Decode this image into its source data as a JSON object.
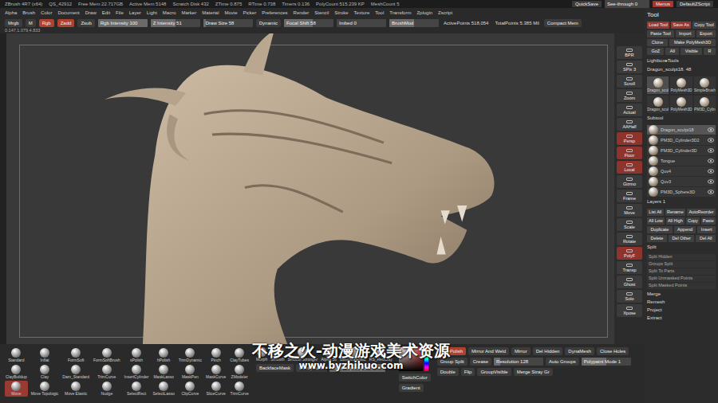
{
  "title_bar": {
    "app": "ZBrush 4R7 (x64)",
    "items": [
      "QS_42912",
      "Free Mem 22.717GB",
      "Active Mem 5148",
      "Scratch Disk 432",
      "ZTime 0.875",
      "RTime 0.738",
      "Timers 0.136",
      "PolyCount 515.239 KP",
      "MeshCount 5"
    ],
    "right": [
      {
        "label": "QuickSave",
        "kind": "button",
        "selected": false,
        "level": 0
      },
      {
        "label": "See-through 0",
        "kind": "slider",
        "selected": false,
        "level": 0
      },
      {
        "label": "Menus",
        "kind": "button",
        "selected": true,
        "level": 0
      },
      {
        "label": "DefaultZScript",
        "kind": "button",
        "selected": false,
        "level": 0
      }
    ]
  },
  "menu": [
    "Alpha",
    "Brush",
    "Color",
    "Document",
    "Draw",
    "Edit",
    "File",
    "Layer",
    "Light",
    "Macro",
    "Marker",
    "Material",
    "Movie",
    "Picker",
    "Preferences",
    "Render",
    "Stencil",
    "Stroke",
    "Texture",
    "Tool",
    "Transform",
    "Zplugin",
    "Zscript"
  ],
  "top_shelf": {
    "coords": "0.147,1.079,4.833",
    "items": [
      {
        "label": "Mrgb",
        "kind": "button",
        "selected": false,
        "level": 0
      },
      {
        "label": "M",
        "kind": "button",
        "selected": false,
        "level": 0
      },
      {
        "label": "Rgb",
        "kind": "button",
        "selected": true,
        "level": 0
      },
      {
        "label": "Zadd",
        "kind": "button",
        "selected": true,
        "level": 0
      },
      {
        "label": "Zsub",
        "kind": "button",
        "selected": false,
        "level": 0
      },
      {
        "label": "Rgb Intensity 100",
        "kind": "slider",
        "selected": false,
        "level": 1
      },
      {
        "label": "Z Intensity 51",
        "kind": "slider",
        "selected": false,
        "level": 0.51
      },
      {
        "label": "Draw Size 58",
        "kind": "slider",
        "selected": false,
        "level": 0.06
      },
      {
        "label": "Dynamic",
        "kind": "button",
        "selected": false,
        "level": 0
      },
      {
        "label": "Focal Shift 58",
        "kind": "slider",
        "selected": false,
        "level": 0.58
      },
      {
        "label": "Imbed 0",
        "kind": "slider",
        "selected": false,
        "level": 0
      },
      {
        "label": "BrushMod",
        "kind": "slider",
        "selected": false,
        "level": 0.5
      },
      {
        "label": "ActivePoints 518,054",
        "kind": "info",
        "selected": false,
        "level": 0
      },
      {
        "label": "TotalPoints 5.385 Mil",
        "kind": "info",
        "selected": false,
        "level": 0
      },
      {
        "label": "Compact Mem",
        "kind": "button",
        "selected": false,
        "level": 0
      }
    ]
  },
  "view_icons": [
    {
      "label": "BPR",
      "selected": false
    },
    {
      "label": "SPix 3",
      "selected": false
    },
    {
      "label": "Scroll",
      "selected": false
    },
    {
      "label": "Zoom",
      "selected": false
    },
    {
      "label": "Actual",
      "selected": false
    },
    {
      "label": "AAHalf",
      "selected": false
    },
    {
      "label": "Persp",
      "selected": true
    },
    {
      "label": "Floor",
      "selected": true
    },
    {
      "label": "Local",
      "selected": true
    },
    {
      "label": "Gizmo",
      "selected": false
    },
    {
      "label": "Frame",
      "selected": false
    },
    {
      "label": "Move",
      "selected": false
    },
    {
      "label": "Scale",
      "selected": false
    },
    {
      "label": "Rotate",
      "selected": false
    },
    {
      "label": "PolyF",
      "selected": true
    },
    {
      "label": "Transp",
      "selected": false
    },
    {
      "label": "Ghost",
      "selected": false
    },
    {
      "label": "Solo",
      "selected": false
    },
    {
      "label": "Xpose",
      "selected": false
    }
  ],
  "tool_palette": {
    "title": "Tool",
    "buttons": [
      {
        "label": "Load Tool",
        "selected": true
      },
      {
        "label": "Save As",
        "selected": true
      },
      {
        "label": "Copy Tool",
        "selected": false
      },
      {
        "label": "Paste Tool",
        "selected": false
      },
      {
        "label": "Import",
        "selected": false
      },
      {
        "label": "Export",
        "selected": false
      },
      {
        "label": "Clone",
        "selected": false
      },
      {
        "label": "Make PolyMesh3D",
        "selected": false
      },
      {
        "label": "GoZ",
        "selected": false
      },
      {
        "label": "All",
        "selected": false
      },
      {
        "label": "Visible",
        "selected": false
      },
      {
        "label": "R",
        "selected": false
      }
    ],
    "lightbox": "Lightbox▸Tools",
    "current_tool": "Dragon_sculpt18. 48",
    "tools": [
      {
        "label": "Dragon_scul",
        "selected": true
      },
      {
        "label": "PolyMesh3D",
        "selected": false
      },
      {
        "label": "SimpleBrush",
        "selected": false
      },
      {
        "label": "Dragon_scul",
        "selected": false
      },
      {
        "label": "PolyMesh3D",
        "selected": false
      },
      {
        "label": "PM3D_Cylin",
        "selected": false
      }
    ],
    "subtool_title": "Subtool",
    "subtools": [
      {
        "label": "Dragon_sculpt18",
        "selected": true,
        "visible": true
      },
      {
        "label": "PM3D_Cylinder3D2",
        "selected": false,
        "visible": true
      },
      {
        "label": "PM3D_Cylinder3D",
        "selected": false,
        "visible": true
      },
      {
        "label": "Tongue",
        "selected": false,
        "visible": true
      },
      {
        "label": "Quv4",
        "selected": false,
        "visible": true
      },
      {
        "label": "Quv3",
        "selected": false,
        "visible": true
      },
      {
        "label": "PM3D_Sphere3D",
        "selected": false,
        "visible": true
      }
    ],
    "layers": "Layers 1",
    "list_buttons": [
      {
        "label": "List All",
        "selected": false
      },
      {
        "label": "Rename",
        "selected": false
      },
      {
        "label": "AutoReorder",
        "selected": false
      },
      {
        "label": "All Low",
        "selected": false
      },
      {
        "label": "All High",
        "selected": false
      },
      {
        "label": "Copy",
        "selected": false
      },
      {
        "label": "Paste",
        "selected": false
      },
      {
        "label": "Duplicate",
        "selected": false
      },
      {
        "label": "Append",
        "selected": false
      },
      {
        "label": "Insert",
        "selected": false
      },
      {
        "label": "Delete",
        "selected": false
      },
      {
        "label": "Del Other",
        "selected": false
      },
      {
        "label": "Del All",
        "selected": false
      }
    ],
    "split_title": "Split",
    "split_items": [
      "Split Hidden",
      "Groups Split",
      "Split To Parts",
      "Split Unmasked Points",
      "Split Masked Points"
    ],
    "more": [
      "Merge",
      "Remesh",
      "Project",
      "Extract"
    ]
  },
  "brushes": [
    {
      "label": "Standard",
      "selected": false
    },
    {
      "label": "Inflat",
      "selected": false
    },
    {
      "label": "FormSoft",
      "selected": false
    },
    {
      "label": "FormSoftBrush",
      "selected": false
    },
    {
      "label": "sPolish",
      "selected": false
    },
    {
      "label": "hPolish",
      "selected": false
    },
    {
      "label": "TrimDynamic",
      "selected": false
    },
    {
      "label": "Pinch",
      "selected": false
    },
    {
      "label": "ClayTubes",
      "selected": false
    },
    {
      "label": "ClayBuildup",
      "selected": false
    },
    {
      "label": "Clay",
      "selected": false
    },
    {
      "label": "Dam_Standard",
      "selected": false
    },
    {
      "label": "TrimCurve",
      "selected": false
    },
    {
      "label": "InsertCylinder",
      "selected": false
    },
    {
      "label": "MaskLasso",
      "selected": false
    },
    {
      "label": "MaskPen",
      "selected": false
    },
    {
      "label": "MaskCurve",
      "selected": false
    },
    {
      "label": "ZModeler",
      "selected": false
    },
    {
      "label": "Move",
      "selected": true
    },
    {
      "label": "Move Topologic",
      "selected": false
    },
    {
      "label": "Move Elastic",
      "selected": false
    },
    {
      "label": "Nudge",
      "selected": false
    },
    {
      "label": "SelectRect",
      "selected": false
    },
    {
      "label": "SelectLasso",
      "selected": false
    },
    {
      "label": "ClipCurve",
      "selected": false
    },
    {
      "label": "SliceCurve",
      "selected": false
    },
    {
      "label": "TrimCurve",
      "selected": false
    }
  ],
  "materials": [
    "Morph",
    "Smooth",
    "Smooth Stronger",
    "Alpha 58",
    "BasicMaterial2",
    "RS_RedClay"
  ],
  "mask_controls": [
    {
      "label": "BackfaceMask",
      "kind": "button",
      "selected": false,
      "level": 0
    },
    {
      "label": "CavityMask",
      "kind": "button",
      "selected": false,
      "level": 0
    },
    {
      "label": "Model Opacity 100",
      "kind": "slider",
      "selected": false,
      "level": 1
    }
  ],
  "color_controls": [
    "SwitchColor",
    "Gradient"
  ],
  "geometry_controls": [
    {
      "label": "ClayPolish",
      "kind": "button",
      "selected": true,
      "level": 0
    },
    {
      "label": "Mirror And Weld",
      "kind": "button",
      "selected": false,
      "level": 0
    },
    {
      "label": "Mirror",
      "kind": "button",
      "selected": false,
      "level": 0
    },
    {
      "label": "Del Hidden",
      "kind": "button",
      "selected": false,
      "level": 0
    },
    {
      "label": "DynaMesh",
      "kind": "button",
      "selected": false,
      "level": 0
    },
    {
      "label": "Close Holes",
      "kind": "button",
      "selected": false,
      "level": 0
    },
    {
      "label": "Group Split",
      "kind": "button",
      "selected": false,
      "level": 0
    },
    {
      "label": "Crease",
      "kind": "button",
      "selected": false,
      "level": 0
    },
    {
      "label": "Resolution 128",
      "kind": "slider",
      "selected": false,
      "level": 0.12
    },
    {
      "label": "Auto Groups",
      "kind": "button",
      "selected": false,
      "level": 0
    },
    {
      "label": "Polypaint Mode 1",
      "kind": "slider",
      "selected": false,
      "level": 0.5
    },
    {
      "label": "Double",
      "kind": "button",
      "selected": false,
      "level": 0
    },
    {
      "label": "Flip",
      "kind": "button",
      "selected": false,
      "level": 0
    },
    {
      "label": "GroupVisible",
      "kind": "button",
      "selected": false,
      "level": 0
    },
    {
      "label": "Merge Stray Gr",
      "kind": "button",
      "selected": false,
      "level": 0
    }
  ],
  "watermark": {
    "title": "不移之火-动漫游戏美术资源",
    "url": "www.byzhihuo.com"
  }
}
